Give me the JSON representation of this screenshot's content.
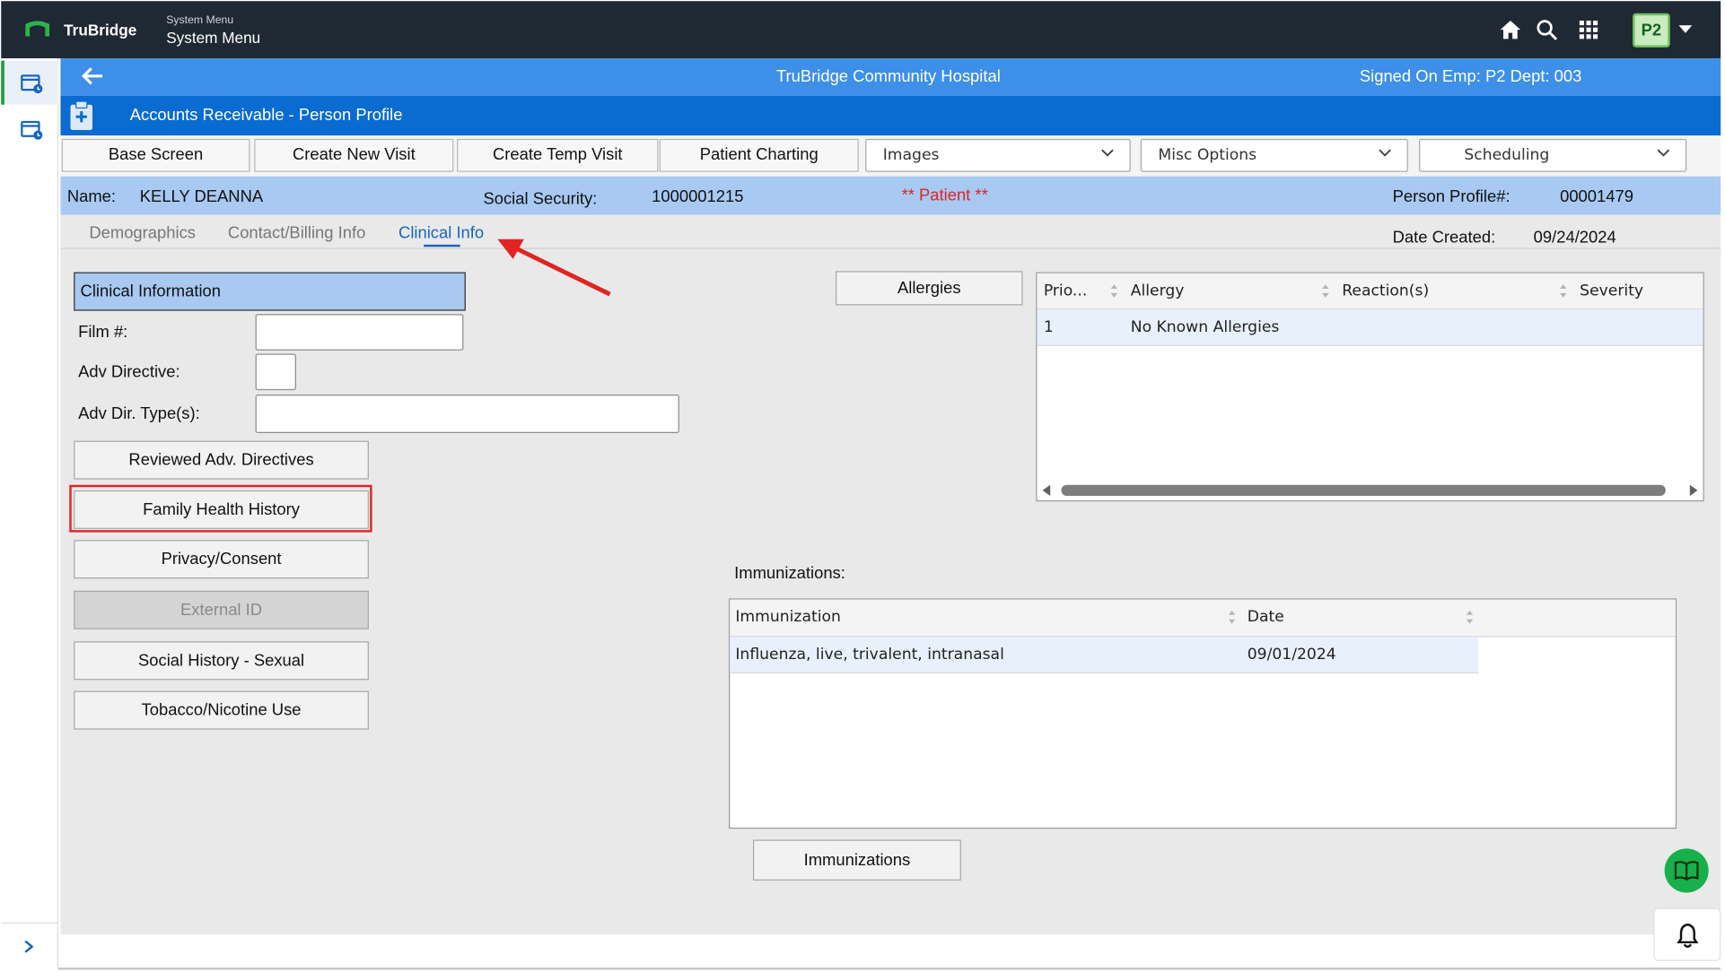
{
  "topbar": {
    "brand": "TruBridge",
    "system_menu_small": "System Menu",
    "system_menu_big": "System Menu",
    "user_initials": "P2",
    "icons": [
      "home-icon",
      "search-icon",
      "apps-grid-icon",
      "chevron-down-icon"
    ]
  },
  "header": {
    "hospital": "TruBridge Community Hospital",
    "signed_on": "Signed On Emp: P2 Dept: 003",
    "module_title": "Accounts Receivable - Person Profile"
  },
  "toolbar": {
    "base_screen": "Base Screen",
    "create_new_visit": "Create New Visit",
    "create_temp_visit": "Create Temp Visit",
    "patient_charting": "Patient Charting",
    "images": "Images",
    "misc_options": "Misc Options",
    "scheduling": "Scheduling"
  },
  "patient": {
    "name_label": "Name:",
    "name_value": "KELLY DEANNA",
    "ssn_label": "Social Security:",
    "ssn_value": "1000001215",
    "patient_tag": "** Patient **",
    "profile_label": "Person Profile#:",
    "profile_value": "00001479",
    "date_created_label": "Date Created:",
    "date_created_value": "09/24/2024"
  },
  "tabs": {
    "demographics": "Demographics",
    "contact_billing": "Contact/Billing Info",
    "clinical_info": "Clinical Info"
  },
  "clinical": {
    "section_title": "Clinical Information",
    "film_label": "Film #:",
    "film_value": "",
    "adv_directive_label": "Adv Directive:",
    "adv_directive_value": "",
    "adv_dir_types_label": "Adv Dir. Type(s):",
    "adv_dir_types_value": "",
    "buttons": {
      "reviewed_adv_directives": "Reviewed Adv. Directives",
      "family_health_history": "Family Health History",
      "privacy_consent": "Privacy/Consent",
      "external_id": "External ID",
      "social_history_sexual": "Social History - Sexual",
      "tobacco_nicotine": "Tobacco/Nicotine Use"
    }
  },
  "allergies": {
    "button": "Allergies",
    "columns": [
      "Prio...",
      "Allergy",
      "Reaction(s)",
      "Severity"
    ],
    "rows": [
      {
        "priority": "1",
        "allergy": "No Known Allergies",
        "reactions": "",
        "severity": ""
      }
    ]
  },
  "immunizations": {
    "label": "Immunizations:",
    "columns": [
      "Immunization",
      "Date"
    ],
    "rows": [
      {
        "name": "Influenza, live, trivalent, intranasal",
        "date": "09/01/2024"
      }
    ],
    "button": "Immunizations"
  },
  "colors": {
    "header_light_blue": "#3d8fe8",
    "header_dark_blue": "#0a6bd1",
    "patient_bar": "#a8c9f1",
    "annotation_red": "#e02424",
    "brand_green": "#1e9e3e"
  }
}
